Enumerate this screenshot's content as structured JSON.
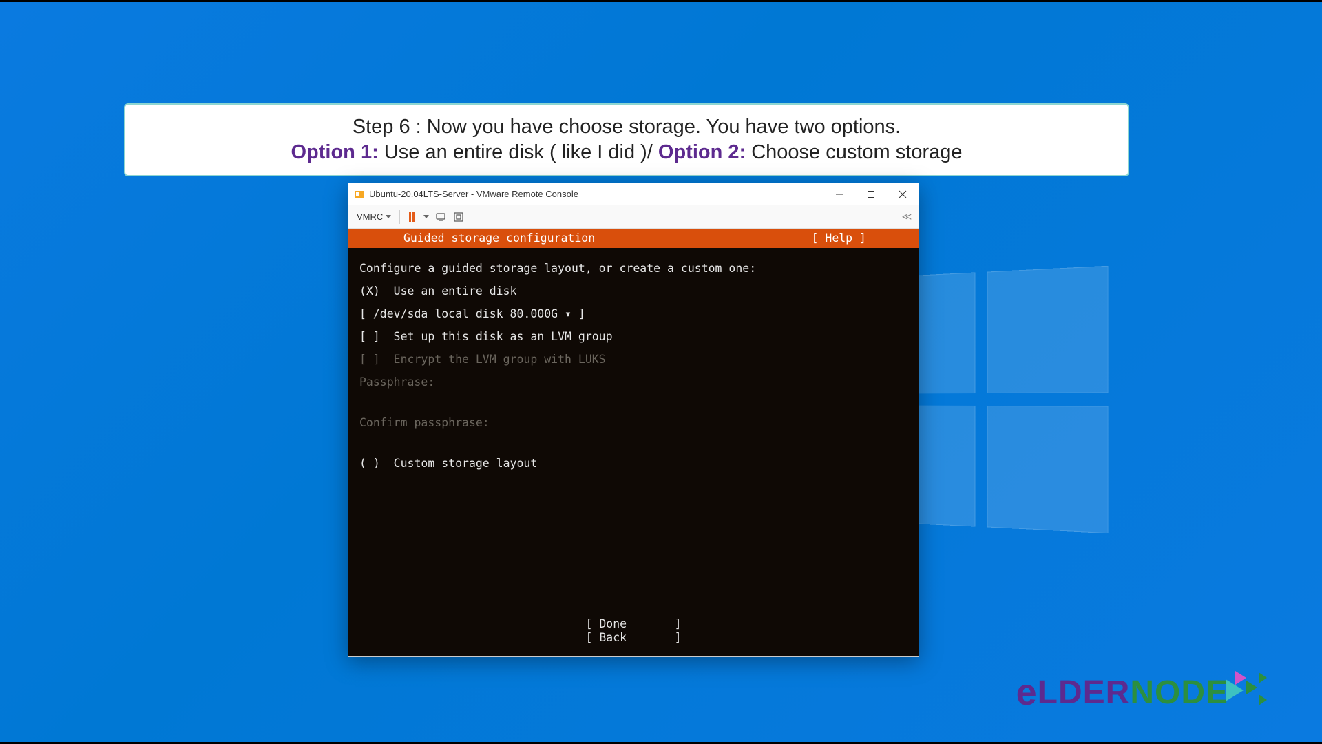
{
  "banner": {
    "line1": "Step 6 : Now you have choose storage. You have two options.",
    "option1_label": "Option 1:",
    "option1_text": " Use an entire disk ( like I did )/ ",
    "option2_label": "Option 2:",
    "option2_text": " Choose custom storage"
  },
  "window": {
    "title": "Ubuntu-20.04LTS-Server - VMware Remote Console",
    "vmrc_label": "VMRC"
  },
  "installer": {
    "header_title": "Guided storage configuration",
    "header_help": "[ Help ]",
    "intro": "Configure a guided storage layout, or create a custom one:",
    "opt_entire_prefix": "(",
    "opt_entire_marker": "X",
    "opt_entire_suffix": ")  Use an entire disk",
    "disk_selector": "[ /dev/sda local disk 80.000G ▾ ]",
    "lvm_checkbox": "[ ]  Set up this disk as an LVM group",
    "encrypt_checkbox": "[ ]  Encrypt the LVM group with LUKS",
    "passphrase_label": "Passphrase:",
    "confirm_label": "Confirm passphrase:",
    "opt_custom": "( )  Custom storage layout",
    "done": "[ Done       ]",
    "back": "[ Back       ]"
  },
  "logo": {
    "part1": "e",
    "part2": "LDER",
    "part3": "NODE"
  }
}
